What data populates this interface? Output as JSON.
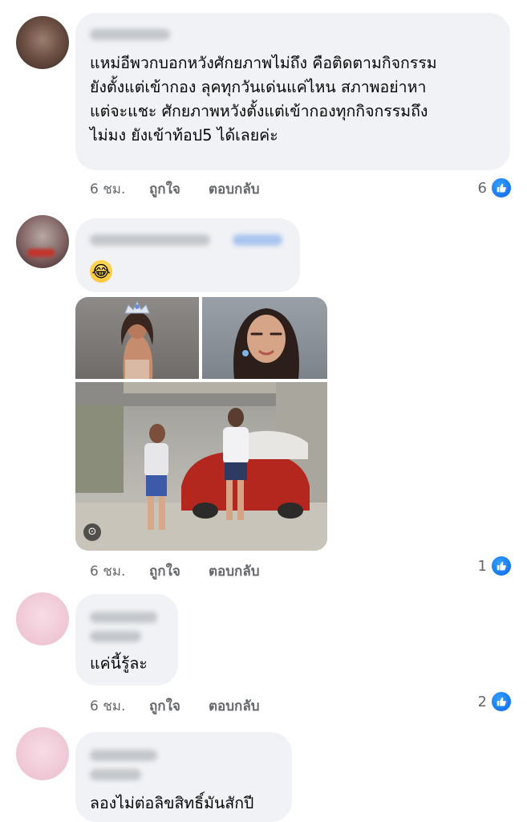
{
  "comments": [
    {
      "lines": [
        "แหม่อีพวกบอกหวังศักยภาพไม่ถึง คือติดตามกิจกรรม",
        "ยังตั้งแต่เข้ากอง ลุคทุกวันเด่นแค่ไหน สภาพอย่าหา",
        "แต่จะแชะ ศักยภาพหวังตั้งแต่เข้ากองทุกกิจกรรมถึง",
        "ไม่มง ยังเข้าท้อป5 ได้เลยค่ะ"
      ],
      "time": "6 ชม.",
      "like": "ถูกใจ",
      "reply": "ตอบกลับ",
      "reaction_count": "6"
    },
    {
      "emoji": "😂",
      "time": "6 ชม.",
      "like": "ถูกใจ",
      "reply": "ตอบกลับ",
      "reaction_count": "1"
    },
    {
      "text": "แค่นี้รู้ละ",
      "time": "6 ชม.",
      "like": "ถูกใจ",
      "reply": "ตอบกลับ",
      "reaction_count": "2"
    },
    {
      "text": "ลองไม่ต่อลิขสิทธิ์มันสักปี"
    }
  ],
  "icons": {
    "like_reaction": "thumbs-up-icon",
    "photo_badge": "search-lens-icon"
  },
  "colors": {
    "bubble_bg": "#f0f2f5",
    "meta_text": "#65676b",
    "like_blue": "#1877f2"
  }
}
